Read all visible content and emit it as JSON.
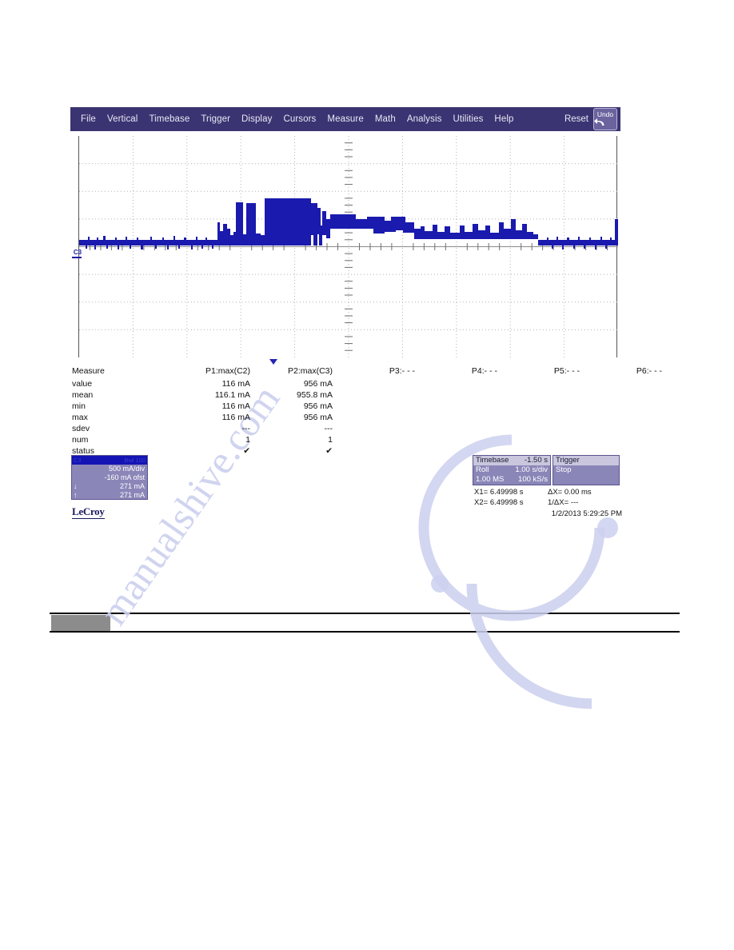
{
  "scope": {
    "menubar": {
      "items": [
        {
          "label": "File",
          "name": "menu-file"
        },
        {
          "label": "Vertical",
          "name": "menu-vertical"
        },
        {
          "label": "Timebase",
          "name": "menu-timebase"
        },
        {
          "label": "Trigger",
          "name": "menu-trigger"
        },
        {
          "label": "Display",
          "name": "menu-display"
        },
        {
          "label": "Cursors",
          "name": "menu-cursors"
        },
        {
          "label": "Measure",
          "name": "menu-measure"
        },
        {
          "label": "Math",
          "name": "menu-math"
        },
        {
          "label": "Analysis",
          "name": "menu-analysis"
        },
        {
          "label": "Utilities",
          "name": "menu-utilities"
        },
        {
          "label": "Help",
          "name": "menu-help"
        }
      ],
      "reset_label": "Reset",
      "undo_label": "Undo",
      "undo_icon": "undo-arrow-icon",
      "bar_color": "#3b3472"
    },
    "graticule": {
      "channel_marker": "C3",
      "trigger_marker_icon": "trigger-position-marker",
      "trace_color": "#1a1aae",
      "grid_color": "#b0b0b0"
    },
    "measure": {
      "title": "Measure",
      "row_labels": [
        "value",
        "mean",
        "min",
        "max",
        "sdev",
        "num",
        "status"
      ],
      "columns": [
        {
          "header": "P1:max(C2)",
          "values": [
            "116 mA",
            "116.1 mA",
            "116 mA",
            "116 mA",
            "---",
            "1",
            "✔"
          ]
        },
        {
          "header": "P2:max(C3)",
          "values": [
            "956 mA",
            "955.8 mA",
            "956 mA",
            "956 mA",
            "---",
            "1",
            "✔"
          ]
        },
        {
          "header": "P3:- - -",
          "values": [
            "",
            "",
            "",
            "",
            "",
            "",
            ""
          ]
        },
        {
          "header": "P4:- - -",
          "values": [
            "",
            "",
            "",
            "",
            "",
            "",
            ""
          ]
        },
        {
          "header": "P5:- - -",
          "values": [
            "",
            "",
            "",
            "",
            "",
            "",
            ""
          ]
        },
        {
          "header": "P6:- - -",
          "values": [
            "",
            "",
            "",
            "",
            "",
            "",
            ""
          ]
        }
      ]
    },
    "channel_box": {
      "header_left": "C3",
      "header_right": "Bwl 100",
      "scale": "500 mA/div",
      "offset": "-160 mA ofst",
      "down_arrow_icon": "arrow-down-icon",
      "down_value": "271 mA",
      "up_arrow_icon": "arrow-up-icon",
      "up_value": "271 mA"
    },
    "brand": "LeCroy",
    "timebase_box": {
      "header_label": "Timebase",
      "header_value": "-1.50 s",
      "mode": "Roll",
      "scale": "1.00 s/div",
      "memory": "1.00 MS",
      "sample_rate": "100 kS/s"
    },
    "trigger_box": {
      "header_label": "Trigger",
      "state": "Stop"
    },
    "cursors": {
      "x1_label": "X1=",
      "x1_value": "6.49998 s",
      "dx_label": "ΔX=",
      "dx_value": "0.00 ms",
      "x2_label": "X2=",
      "x2_value": "6.49998 s",
      "invdx_label": "1/ΔX=",
      "invdx_value": "---"
    },
    "timestamp": "1/2/2013 5:29:25 PM"
  },
  "page": {
    "watermark": "manualshive.com"
  }
}
